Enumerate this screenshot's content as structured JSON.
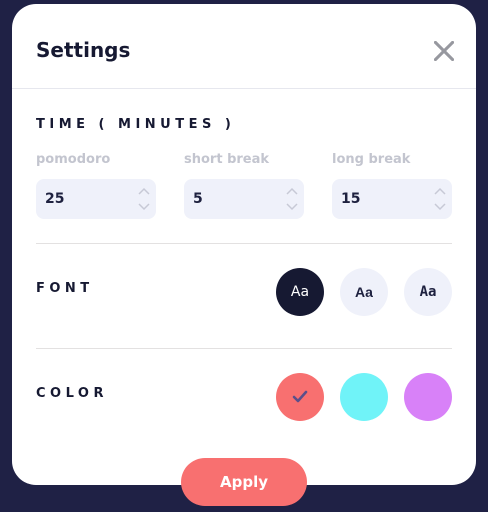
{
  "header": {
    "title": "Settings"
  },
  "time": {
    "label": "TIME ( MINUTES )",
    "fields": [
      {
        "label": "pomodoro",
        "value": "25"
      },
      {
        "label": "short break",
        "value": "5"
      },
      {
        "label": "long break",
        "value": "15"
      }
    ]
  },
  "font": {
    "label": "FONT",
    "options": [
      {
        "label": "Aa",
        "selected": true
      },
      {
        "label": "Aa",
        "selected": false
      },
      {
        "label": "Aa",
        "selected": false
      }
    ]
  },
  "color": {
    "label": "COLOR",
    "options": [
      {
        "hex": "#f87070",
        "selected": true
      },
      {
        "hex": "#70f3f8",
        "selected": false
      },
      {
        "hex": "#d881f8",
        "selected": false
      }
    ]
  },
  "apply_label": "Apply",
  "colors": {
    "background": "#1f2145",
    "dark": "#161932",
    "input_bg": "#eff1fa",
    "accent": "#f87070"
  },
  "icons": {
    "close": "close-icon",
    "stepper_up": "chevron-up-icon",
    "stepper_down": "chevron-down-icon",
    "selected": "checkmark-icon"
  }
}
